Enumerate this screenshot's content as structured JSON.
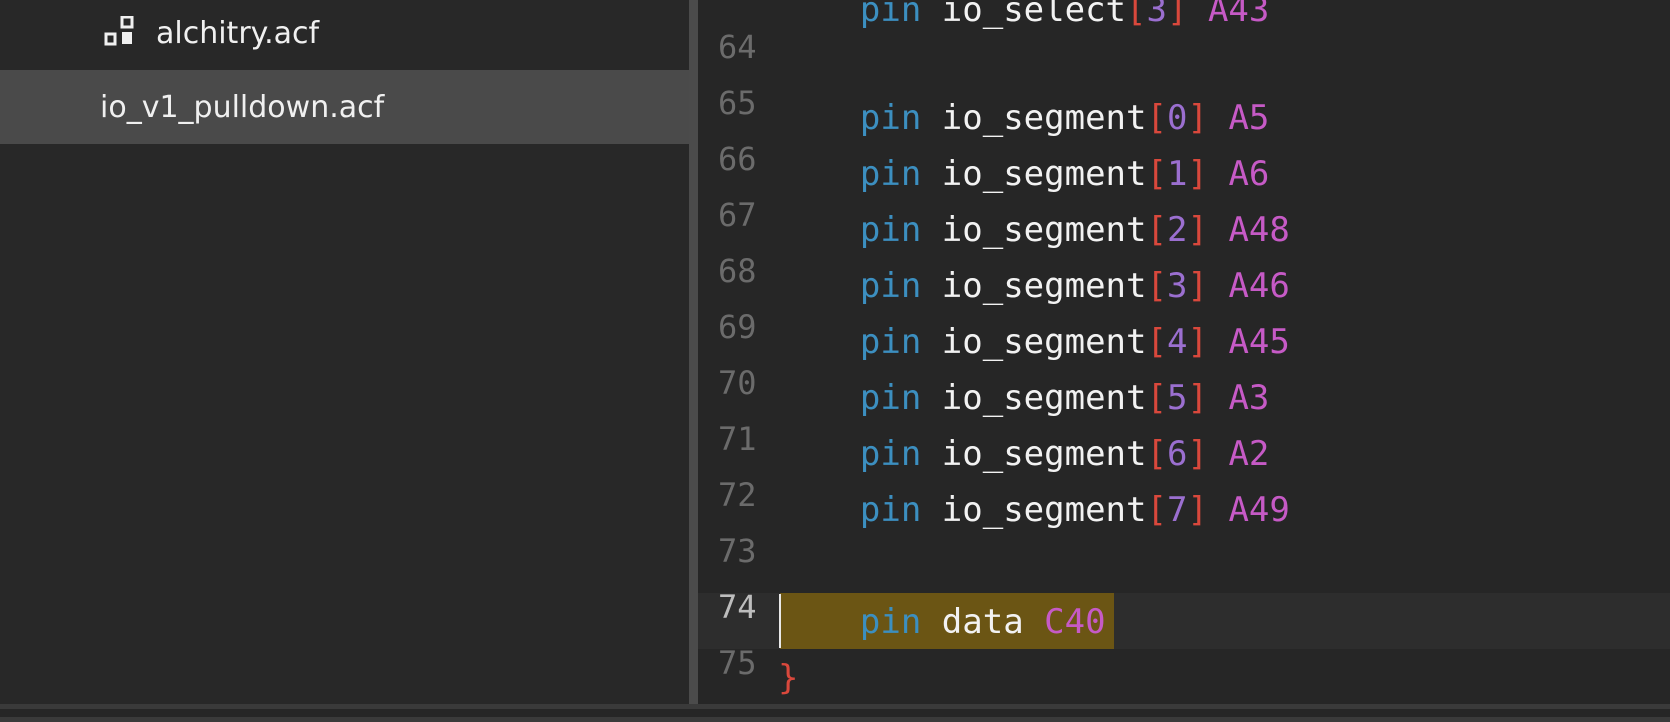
{
  "sidebar": {
    "items": [
      {
        "label": "alchitry.acf",
        "icon": "settings-file-icon",
        "selected": false
      },
      {
        "label": "io_v1_pulldown.acf",
        "icon": "",
        "selected": true
      }
    ]
  },
  "editor": {
    "partial_top_line": {
      "prefix": "pin",
      "name": " io_select",
      "open": "[",
      "index": "3",
      "close": "]",
      "value": " A43"
    },
    "line_numbers": [
      "64",
      "65",
      "66",
      "67",
      "68",
      "69",
      "70",
      "71",
      "72",
      "73",
      "74",
      "75"
    ],
    "active_line": "74",
    "segment_lines": [
      {
        "keyword": "pin",
        "name": "io_segment",
        "index": "0",
        "pin": "A5"
      },
      {
        "keyword": "pin",
        "name": "io_segment",
        "index": "1",
        "pin": "A6"
      },
      {
        "keyword": "pin",
        "name": "io_segment",
        "index": "2",
        "pin": "A48"
      },
      {
        "keyword": "pin",
        "name": "io_segment",
        "index": "3",
        "pin": "A46"
      },
      {
        "keyword": "pin",
        "name": "io_segment",
        "index": "4",
        "pin": "A45"
      },
      {
        "keyword": "pin",
        "name": "io_segment",
        "index": "5",
        "pin": "A3"
      },
      {
        "keyword": "pin",
        "name": "io_segment",
        "index": "6",
        "pin": "A2"
      },
      {
        "keyword": "pin",
        "name": "io_segment",
        "index": "7",
        "pin": "A49"
      }
    ],
    "data_line": {
      "keyword": "pin",
      "name": "data",
      "pin": "C40"
    },
    "closing_brace": "}",
    "bracket_open": "[",
    "bracket_close": "]"
  },
  "colors": {
    "keyword": "#3c8fc0",
    "bracket": "#d9483c",
    "index": "#9b6fd0",
    "pin_value": "#c65ac6",
    "selection": "#6b5514"
  }
}
